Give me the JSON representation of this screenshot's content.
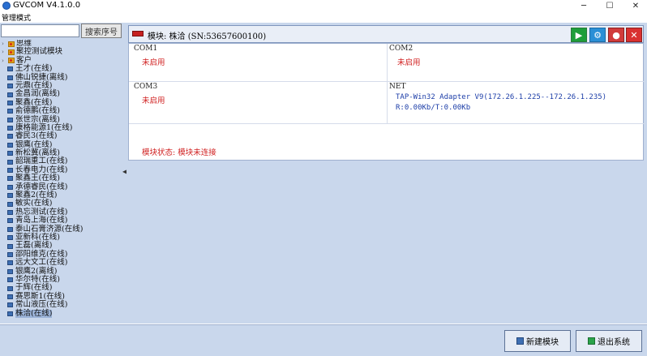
{
  "window": {
    "title": "GVCOM V4.1.0.0",
    "controls": {
      "minimize": "─",
      "maximize": "☐",
      "close": "✕"
    }
  },
  "menu": {
    "items": [
      {
        "label": "管理模式"
      }
    ]
  },
  "search": {
    "value": "",
    "placeholder": "",
    "button_label": "搜索序号"
  },
  "tree": {
    "items": [
      {
        "label": "思维",
        "type": "group"
      },
      {
        "label": "聚控测试模块",
        "type": "group"
      },
      {
        "label": "客户",
        "type": "group"
      },
      {
        "label": "王才(在线)",
        "type": "device"
      },
      {
        "label": "佛山锐捷(离线)",
        "type": "device"
      },
      {
        "label": "元鼎(在线)",
        "type": "device"
      },
      {
        "label": "金昌润(离线)",
        "type": "device"
      },
      {
        "label": "聚鑫(在线)",
        "type": "device"
      },
      {
        "label": "俞德鹏(在线)",
        "type": "device"
      },
      {
        "label": "张世宗(离线)",
        "type": "device"
      },
      {
        "label": "康格能源1(在线)",
        "type": "device"
      },
      {
        "label": "睿民3(在线)",
        "type": "device"
      },
      {
        "label": "银鹰(在线)",
        "type": "device"
      },
      {
        "label": "新松冀(离线)",
        "type": "device"
      },
      {
        "label": "韶瑞重工(在线)",
        "type": "device"
      },
      {
        "label": "长春电力(在线)",
        "type": "device"
      },
      {
        "label": "聚鑫王(在线)",
        "type": "device"
      },
      {
        "label": "承德睿民(在线)",
        "type": "device"
      },
      {
        "label": "聚鑫2(在线)",
        "type": "device"
      },
      {
        "label": "敏实(在线)",
        "type": "device"
      },
      {
        "label": "热忘测试(在线)",
        "type": "device"
      },
      {
        "label": "青岛上海(在线)",
        "type": "device"
      },
      {
        "label": "泰山石膏济源(在线)",
        "type": "device"
      },
      {
        "label": "亚新科(在线)",
        "type": "device"
      },
      {
        "label": "王磊(离线)",
        "type": "device"
      },
      {
        "label": "邵阳维克(在线)",
        "type": "device"
      },
      {
        "label": "远大文工(在线)",
        "type": "device"
      },
      {
        "label": "银鹰2(离线)",
        "type": "device"
      },
      {
        "label": "华尔特(在线)",
        "type": "device"
      },
      {
        "label": "于辉(在线)",
        "type": "device"
      },
      {
        "label": "赛思斯1(在线)",
        "type": "device"
      },
      {
        "label": "常山液压(在线)",
        "type": "device"
      },
      {
        "label": "株洽(在线)",
        "type": "device",
        "selected": true
      }
    ]
  },
  "module": {
    "title": "模块: 株洽 (SN:53657600100)",
    "toolbar": {
      "start_icon": "play-icon",
      "settings_icon": "gear-icon",
      "stop_icon": "stop-icon",
      "close_icon": "close-icon"
    },
    "com1": {
      "name": "COM1",
      "status": "未启用"
    },
    "com2": {
      "name": "COM2",
      "status": "未启用"
    },
    "com3": {
      "name": "COM3",
      "status": "未启用"
    },
    "net": {
      "name": "NET",
      "adapter": "TAP-Win32 Adapter V9(172.26.1.225--172.26.1.235)",
      "traffic": "R:0.00Kb/T:0.00Kb"
    },
    "status": "模块状态: 模块未连接"
  },
  "bottom": {
    "new_label": "新建模块",
    "exit_label": "退出系统"
  },
  "colors": {
    "panel_bg": "#c9d7ec",
    "status_red": "#d02020",
    "net_blue": "#1d3ea8",
    "accent_green": "#1e9e3a"
  }
}
